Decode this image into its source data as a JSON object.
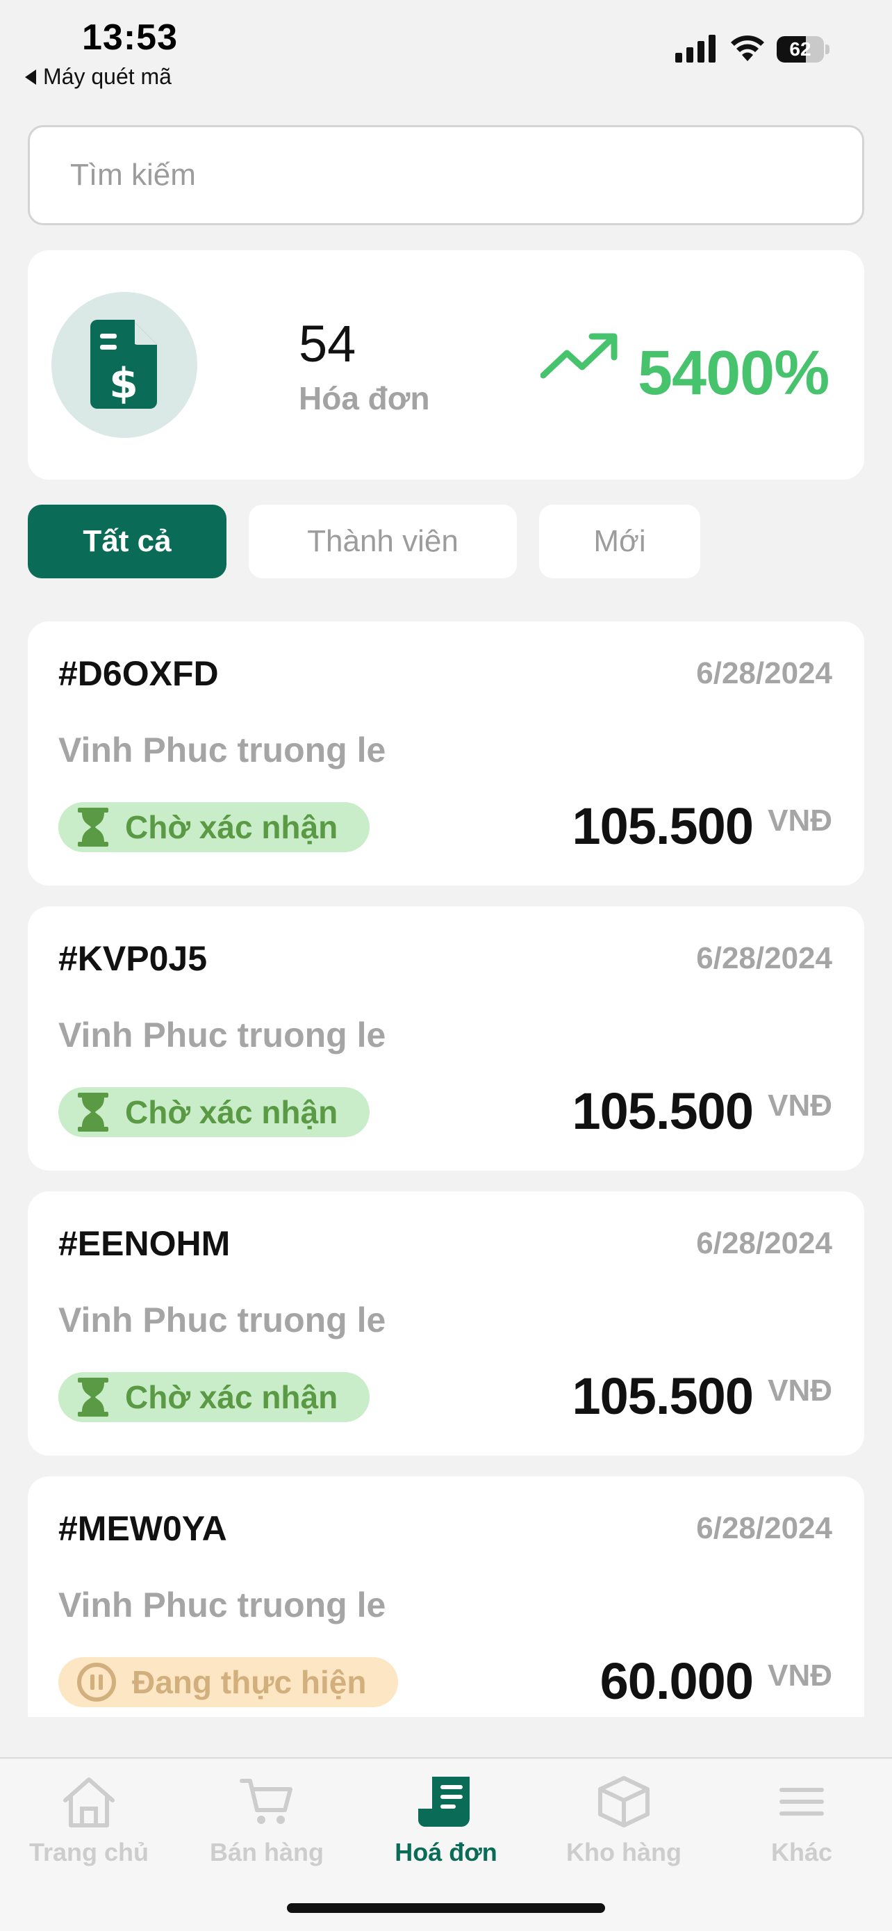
{
  "status_bar": {
    "time": "13:53",
    "back_app": "Máy quét mã",
    "battery": "62",
    "battery_level": 0.62
  },
  "search": {
    "placeholder": "Tìm kiếm"
  },
  "summary": {
    "icon": "invoice-dollar-icon",
    "count": "54",
    "label": "Hóa đơn",
    "trend_icon": "trending-up-icon",
    "percent": "5400%"
  },
  "tabs": [
    {
      "label": "Tất cả",
      "active": true
    },
    {
      "label": "Thành viên",
      "active": false
    },
    {
      "label": "Mới",
      "active": false
    }
  ],
  "invoices": [
    {
      "code": "#D6OXFD",
      "date": "6/28/2024",
      "customer": "Vinh Phuc truong le",
      "status": "Chờ xác nhận",
      "status_icon": "hourglass-icon",
      "amount": "105.500",
      "currency": "VNĐ"
    },
    {
      "code": "#KVP0J5",
      "date": "6/28/2024",
      "customer": "Vinh Phuc truong le",
      "status": "Chờ xác nhận",
      "status_icon": "hourglass-icon",
      "amount": "105.500",
      "currency": "VNĐ"
    },
    {
      "code": "#EENOHM",
      "date": "6/28/2024",
      "customer": "Vinh Phuc truong le",
      "status": "Chờ xác nhận",
      "status_icon": "hourglass-icon",
      "amount": "105.500",
      "currency": "VNĐ"
    },
    {
      "code": "#MEW0YA",
      "date": "6/28/2024",
      "customer": "Vinh Phuc truong le",
      "status": "Đang thực hiện",
      "status_icon": "pause-circle-icon",
      "amount": "60.000",
      "currency": "VNĐ"
    }
  ],
  "bottom_nav": [
    {
      "label": "Trang chủ",
      "icon": "home-icon",
      "active": false
    },
    {
      "label": "Bán hàng",
      "icon": "cart-icon",
      "active": false
    },
    {
      "label": "Hoá đơn",
      "icon": "receipt-icon",
      "active": true
    },
    {
      "label": "Kho hàng",
      "icon": "box-icon",
      "active": false
    },
    {
      "label": "Khác",
      "icon": "menu-icon",
      "active": false
    }
  ],
  "colors": {
    "primary": "#0a6b57",
    "positive": "#48c36d",
    "pending_bg": "#c9ecc9",
    "pending_text": "#5b9a45",
    "progress_bg": "#fce6c4",
    "progress_text": "#d2b07e"
  }
}
